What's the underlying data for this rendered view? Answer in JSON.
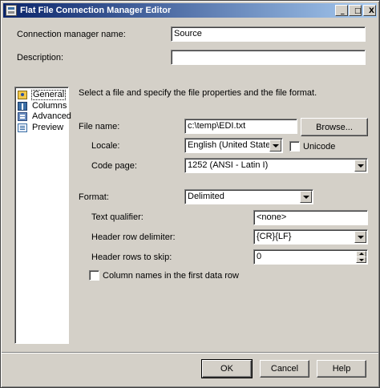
{
  "window": {
    "title": "Flat File Connection Manager Editor",
    "minimize_glyph": "_",
    "maximize_glyph": "□",
    "close_glyph": "X"
  },
  "connection": {
    "name_label": "Connection manager name:",
    "name_value": "Source",
    "description_label": "Description:",
    "description_value": ""
  },
  "nav": {
    "items": [
      {
        "label": "General",
        "icon": "general-icon",
        "selected": true
      },
      {
        "label": "Columns",
        "icon": "columns-icon"
      },
      {
        "label": "Advanced",
        "icon": "advanced-icon"
      },
      {
        "label": "Preview",
        "icon": "preview-icon"
      }
    ]
  },
  "general": {
    "instruction": "Select a file and specify the file properties and the file format.",
    "file_name_label": "File name:",
    "file_name_value": "c:\\temp\\EDI.txt",
    "browse_label": "Browse...",
    "locale_label": "Locale:",
    "locale_value": "English (United States)",
    "unicode_label": "Unicode",
    "code_page_label": "Code page:",
    "code_page_value": "1252  (ANSI - Latin I)",
    "format_label": "Format:",
    "format_value": "Delimited",
    "text_qualifier_label": "Text qualifier:",
    "text_qualifier_value": "<none>",
    "header_row_delimiter_label": "Header row delimiter:",
    "header_row_delimiter_value": "{CR}{LF}",
    "header_rows_to_skip_label": "Header rows to skip:",
    "header_rows_to_skip_value": "0",
    "column_names_label": "Column names in the first data row"
  },
  "footer": {
    "ok_label": "OK",
    "cancel_label": "Cancel",
    "help_label": "Help"
  }
}
